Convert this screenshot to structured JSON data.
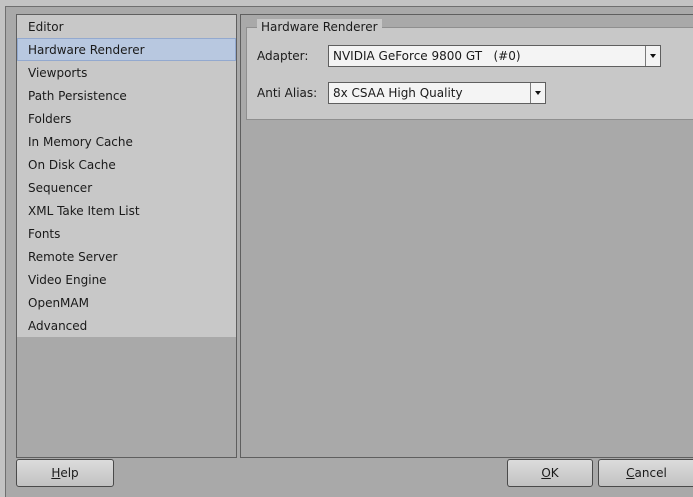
{
  "sidebar": {
    "items": [
      {
        "label": "Editor",
        "selected": false
      },
      {
        "label": "Hardware Renderer",
        "selected": true
      },
      {
        "label": "Viewports",
        "selected": false
      },
      {
        "label": "Path Persistence",
        "selected": false
      },
      {
        "label": "Folders",
        "selected": false
      },
      {
        "label": "In Memory Cache",
        "selected": false
      },
      {
        "label": "On Disk Cache",
        "selected": false
      },
      {
        "label": "Sequencer",
        "selected": false
      },
      {
        "label": "XML Take Item List",
        "selected": false
      },
      {
        "label": "Fonts",
        "selected": false
      },
      {
        "label": "Remote Server",
        "selected": false
      },
      {
        "label": "Video Engine",
        "selected": false
      },
      {
        "label": "OpenMAM",
        "selected": false
      },
      {
        "label": "Advanced",
        "selected": false
      }
    ]
  },
  "group": {
    "title": "Hardware Renderer",
    "adapter_label": "Adapter:",
    "adapter_value": "NVIDIA GeForce 9800 GT   (#0)",
    "antialias_label": "Anti Alias:",
    "antialias_value": "8x CSAA High Quality"
  },
  "buttons": {
    "help_mnemonic": "H",
    "help_rest": "elp",
    "ok_mnemonic": "O",
    "ok_rest": "K",
    "cancel_mnemonic": "C",
    "cancel_rest": "ancel"
  }
}
